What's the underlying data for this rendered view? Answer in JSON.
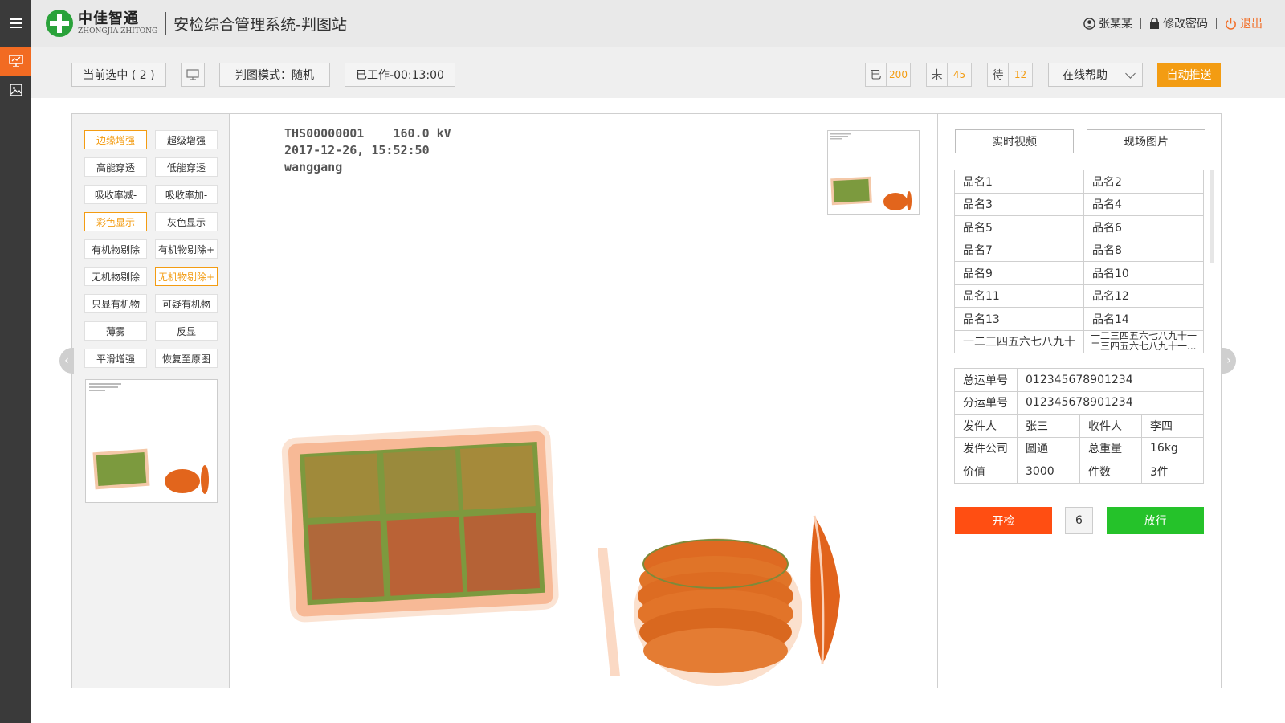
{
  "rail": {
    "items": [
      {
        "icon": "menu-icon"
      },
      {
        "icon": "monitor-chart-icon",
        "active": true
      },
      {
        "icon": "image-icon"
      }
    ]
  },
  "header": {
    "logo_cn": "中佳智通",
    "logo_en": "ZHONGJIA ZHITONG",
    "title": "安检综合管理系统-判图站",
    "user": "张某某",
    "change_password": "修改密码",
    "logout": "退出"
  },
  "toolbar": {
    "selected": "当前选中 ( 2 )",
    "mode": "判图模式：随机",
    "worked": "已工作-00:13:00",
    "counters": [
      {
        "key": "已",
        "value": "200"
      },
      {
        "key": "未",
        "value": "45"
      },
      {
        "key": "待",
        "value": "12"
      }
    ],
    "help": "在线帮助",
    "auto_push": "自动推送"
  },
  "tools": {
    "buttons": [
      {
        "label": "边缘增强",
        "active": true
      },
      {
        "label": "超级增强",
        "active": false
      },
      {
        "label": "高能穿透",
        "active": false
      },
      {
        "label": "低能穿透",
        "active": false
      },
      {
        "label": "吸收率减-",
        "active": false
      },
      {
        "label": "吸收率加-",
        "active": false
      },
      {
        "label": "彩色显示",
        "active": true
      },
      {
        "label": "灰色显示",
        "active": false
      },
      {
        "label": "有机物剔除",
        "active": false
      },
      {
        "label": "有机物剔除+",
        "active": false
      },
      {
        "label": "无机物剔除",
        "active": false
      },
      {
        "label": "无机物剔除+",
        "active": true
      },
      {
        "label": "只显有机物",
        "active": false
      },
      {
        "label": "可疑有机物",
        "active": false
      },
      {
        "label": "薄雾",
        "active": false
      },
      {
        "label": "反显",
        "active": false
      },
      {
        "label": "平滑增强",
        "active": false
      },
      {
        "label": "恢复至原图",
        "active": false
      }
    ]
  },
  "scan": {
    "line1": "THS00000001    160.0 kV",
    "line2": "2017-12-26, 15:52:50",
    "line3": "wanggang"
  },
  "info": {
    "live_video": "实时视频",
    "site_photo": "现场图片",
    "goods": [
      [
        "品名1",
        "品名2"
      ],
      [
        "品名3",
        "品名4"
      ],
      [
        "品名5",
        "品名6"
      ],
      [
        "品名7",
        "品名8"
      ],
      [
        "品名9",
        "品名10"
      ],
      [
        "品名11",
        "品名12"
      ],
      [
        "品名13",
        "品名14"
      ],
      [
        "一二三四五六七八九十",
        "一二三四五六七八九十一二三四五六七八九十一..."
      ]
    ],
    "master_no_label": "总运单号",
    "master_no": "012345678901234",
    "sub_no_label": "分运单号",
    "sub_no": "012345678901234",
    "sender_label": "发件人",
    "sender": "张三",
    "receiver_label": "收件人",
    "receiver": "李四",
    "company_label": "发件公司",
    "company": "圆通",
    "weight_label": "总重量",
    "weight": "16kg",
    "value_label": "价值",
    "value": "3000",
    "pieces_label": "件数",
    "pieces": "3件",
    "open_btn": "开检",
    "count": "6",
    "pass_btn": "放行"
  },
  "colors": {
    "accent": "#f26b22",
    "push": "#f39c12",
    "open": "#ff4e12",
    "pass": "#25c22a",
    "rail": "#3a3a3a"
  }
}
